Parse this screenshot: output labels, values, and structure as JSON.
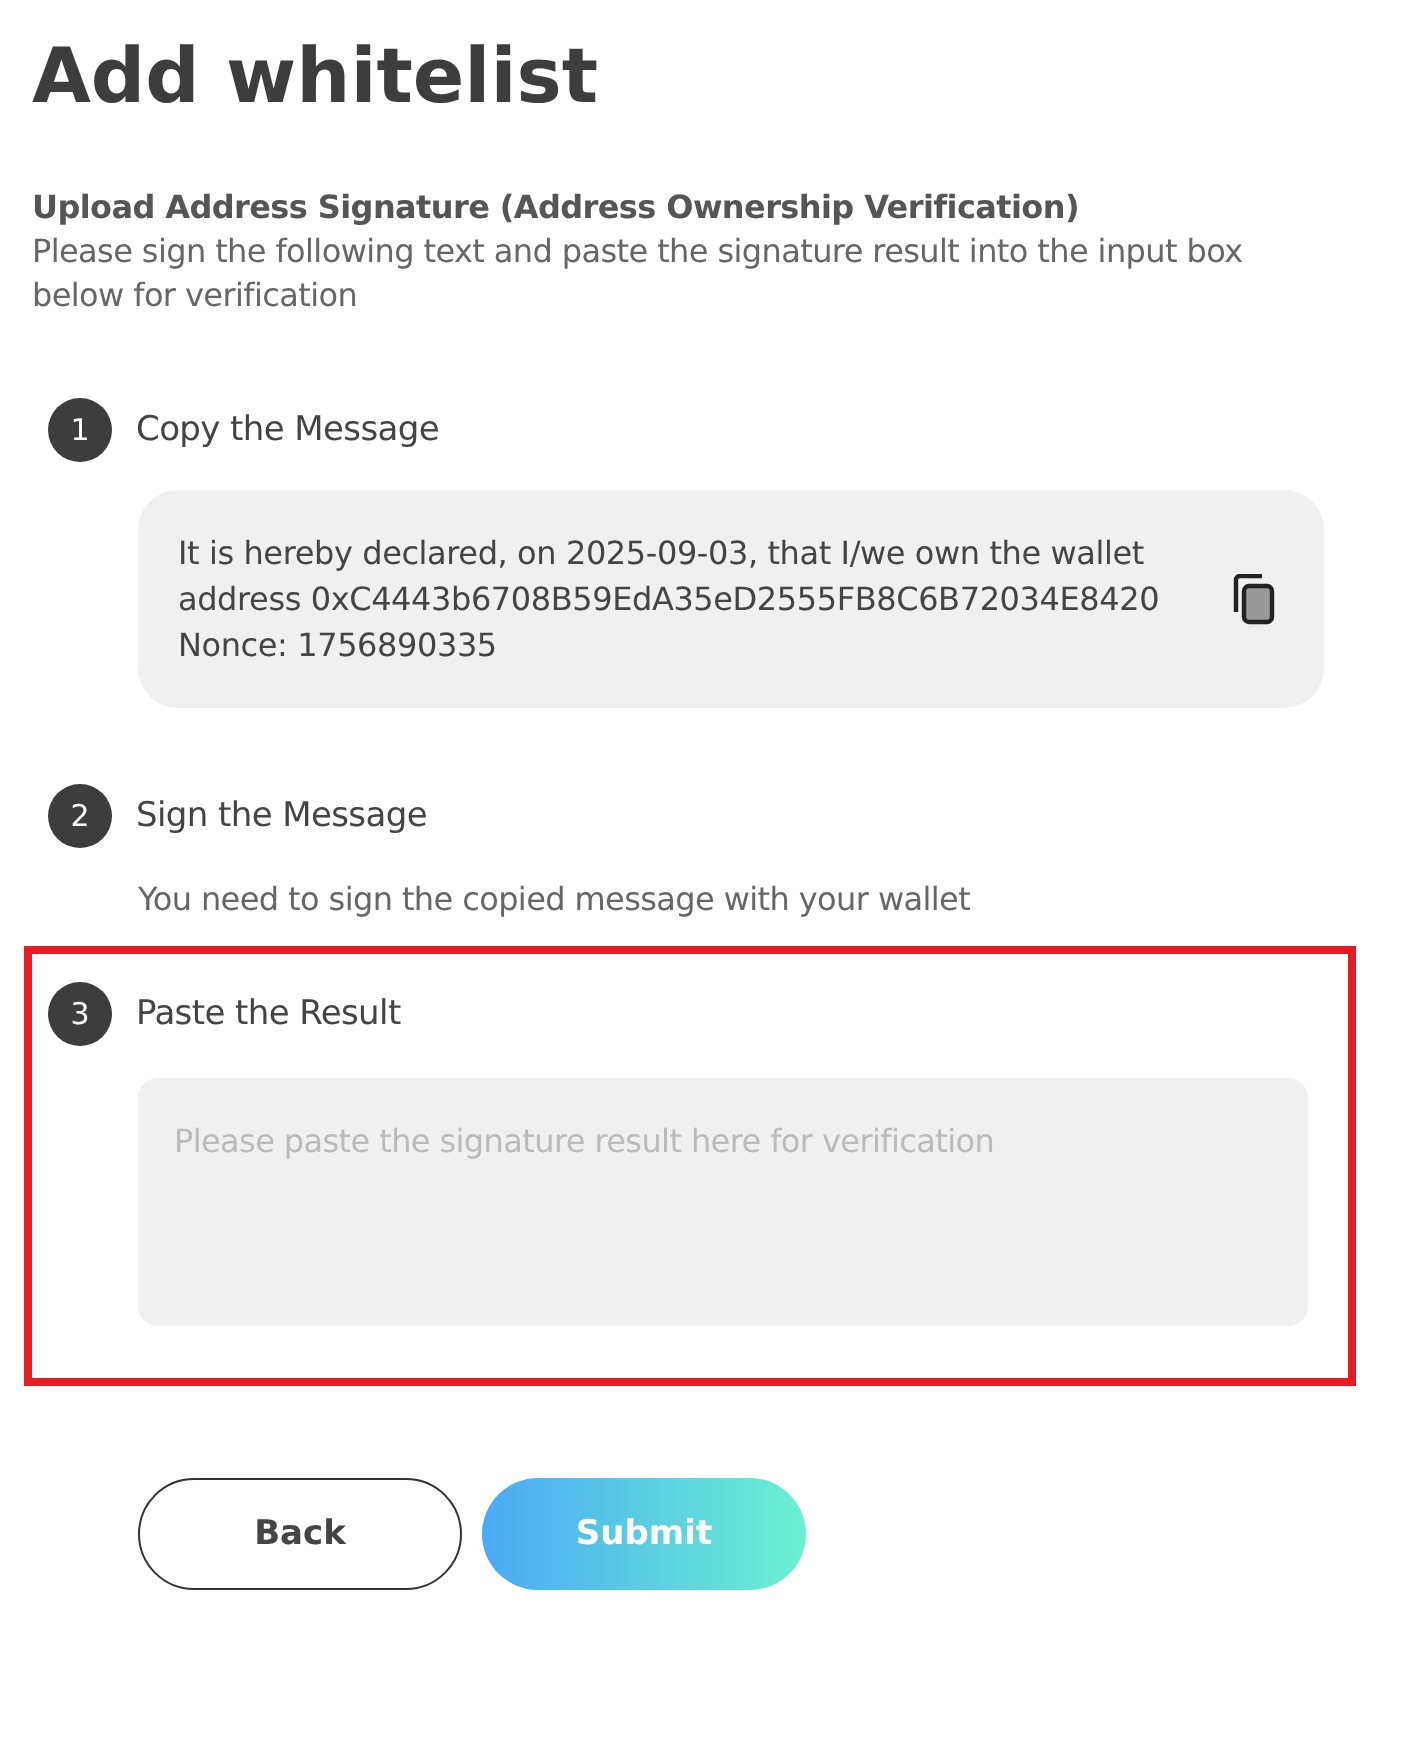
{
  "title": "Add whitelist",
  "subtitle": "Upload Address Signature (Address Ownership Verification)",
  "description": "Please sign the following text and paste the signature result into the input box below for verification",
  "steps": [
    {
      "number": "1",
      "label": "Copy the Message",
      "kind": "message",
      "highlighted": false,
      "message": "It is hereby declared, on 2025-09-03, that I/we own the wallet address 0xC4443b6708B59EdA35eD2555FB8C6B72034E8420 Nonce: 1756890335"
    },
    {
      "number": "2",
      "label": "Sign the Message",
      "kind": "note",
      "highlighted": false,
      "note": "You need to sign the copied message with your wallet"
    },
    {
      "number": "3",
      "label": "Paste the Result",
      "kind": "input",
      "highlighted": true,
      "placeholder": "Please paste the signature result here for verification"
    }
  ],
  "buttons": [
    {
      "label": "Back",
      "kind": "secondary"
    },
    {
      "label": "Submit",
      "kind": "primary"
    }
  ]
}
